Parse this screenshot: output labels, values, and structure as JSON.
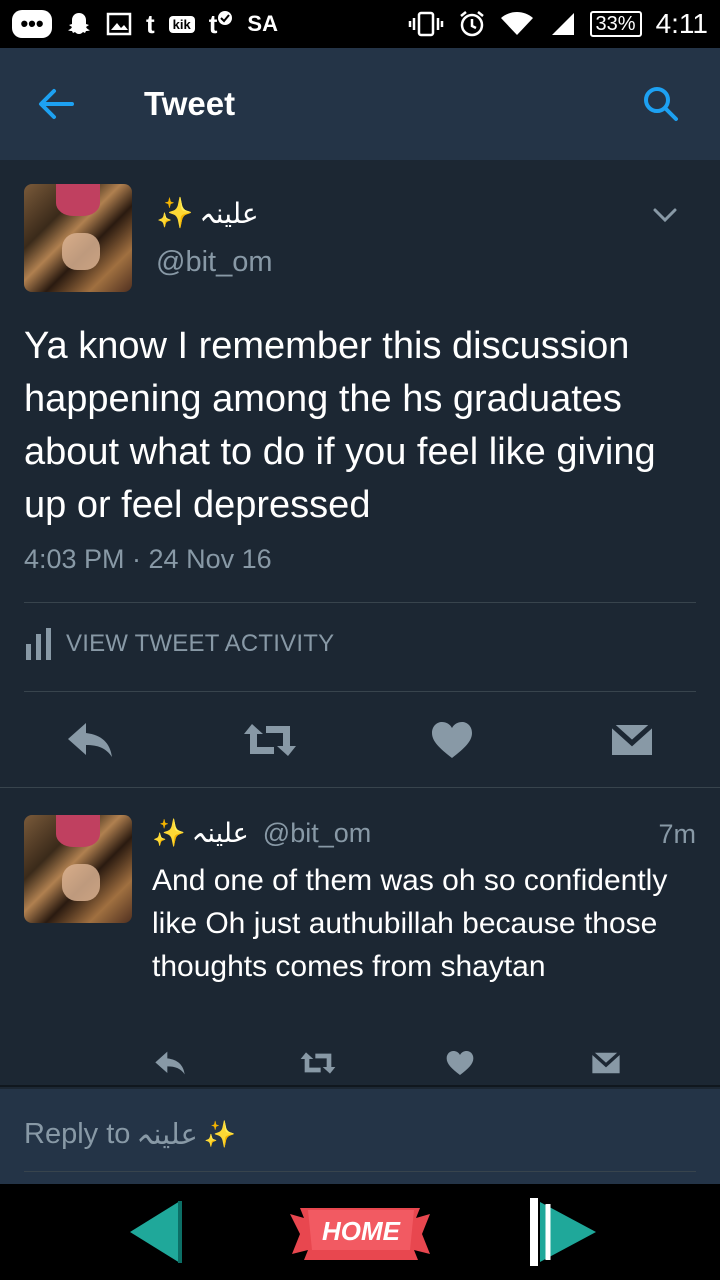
{
  "status_bar": {
    "carrier_label": "SA",
    "battery": "33%",
    "time": "4:11",
    "icons": [
      "chat-bubble-icon",
      "snapchat-icon",
      "gallery-icon",
      "tumblr-icon",
      "kik-icon",
      "tumblr-check-icon",
      "vibrate-icon",
      "alarm-icon",
      "wifi-icon",
      "signal-icon"
    ],
    "kik_label": "kik",
    "tumblr_label": "t"
  },
  "header": {
    "title": "Tweet"
  },
  "main_tweet": {
    "display_name": "علينہ",
    "handle": "@bit_om",
    "text": "Ya know I remember this discussion happening among the hs graduates about what to do if you feel like giving up or feel depressed",
    "timestamp": "4:03 PM · 24 Nov 16",
    "activity_label": "VIEW TWEET ACTIVITY"
  },
  "reply_tweet": {
    "display_name": "علينہ",
    "handle": "@bit_om",
    "age": "7m",
    "text": "And one of them was oh so confidently like Oh just authubillah because those thoughts comes from shaytan"
  },
  "compose": {
    "placeholder": "Reply to",
    "placeholder_name": "علينہ"
  },
  "navbar": {
    "home_label": "HOME"
  },
  "colors": {
    "background": "#1c2733",
    "header": "#243447",
    "accent": "#1da1f2",
    "muted": "#8899a6",
    "sparkle": "#ffcc33",
    "nav_teal": "#1fa89a",
    "home_red": "#e8474f"
  }
}
